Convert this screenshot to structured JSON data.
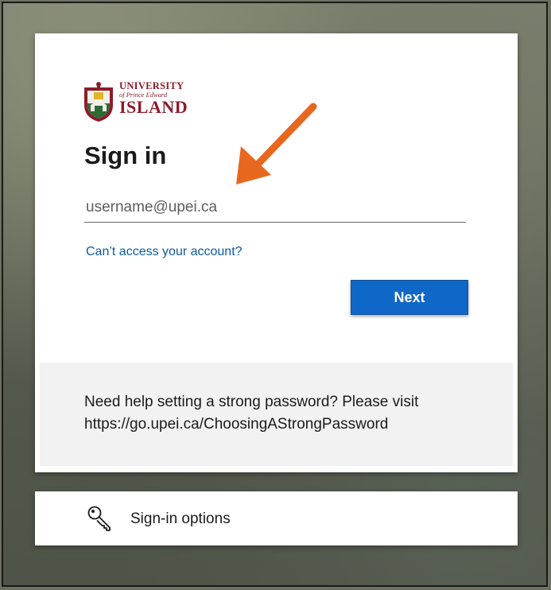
{
  "logo": {
    "line1": "UNIVERSITY",
    "line2": "of Prince Edward",
    "line3": "ISLAND",
    "icon": "university-crest-icon",
    "brand_color": "#8c1d2b"
  },
  "signin": {
    "title": "Sign in",
    "username_placeholder": "username@upei.ca",
    "cant_access_link": "Can’t access your account?",
    "next_button": "Next"
  },
  "help": {
    "line1": "Need help setting a strong password? Please visit",
    "line2": "https://go.upei.ca/ChoosingAStrongPassword"
  },
  "options": {
    "label": "Sign-in options",
    "icon": "key-icon"
  },
  "annotation": {
    "icon": "orange-arrow-icon",
    "color": "#e8671e"
  },
  "colors": {
    "accent": "#0f67c7",
    "link": "#0b5a9c"
  }
}
